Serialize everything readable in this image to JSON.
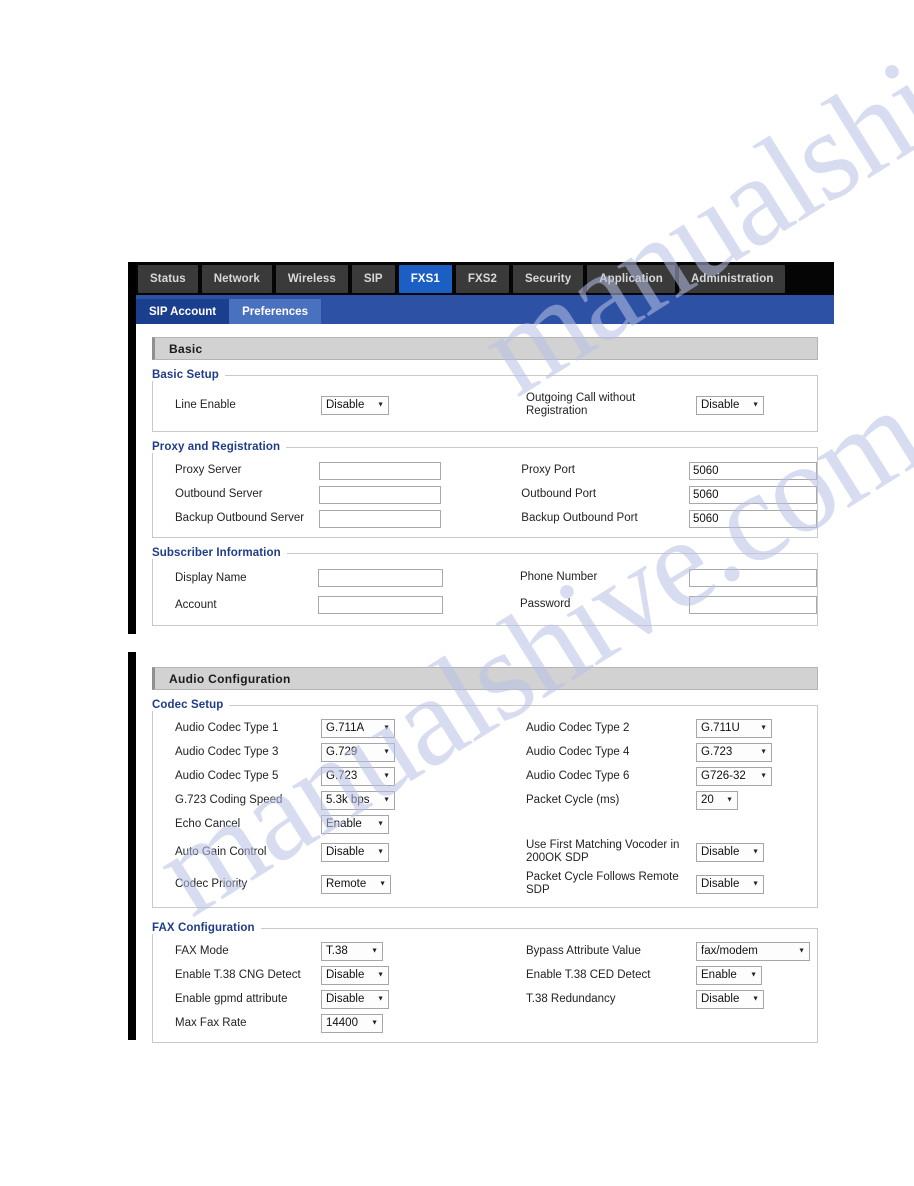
{
  "nav": {
    "tabs": [
      {
        "label": "Status",
        "active": false
      },
      {
        "label": "Network",
        "active": false
      },
      {
        "label": "Wireless",
        "active": false
      },
      {
        "label": "SIP",
        "active": false
      },
      {
        "label": "FXS1",
        "active": true
      },
      {
        "label": "FXS2",
        "active": false
      },
      {
        "label": "Security",
        "active": false
      },
      {
        "label": "Application",
        "active": false
      },
      {
        "label": "Administration",
        "active": false
      }
    ]
  },
  "subnav": {
    "tabs": [
      {
        "label": "SIP Account",
        "active": true
      },
      {
        "label": "Preferences",
        "active": false
      }
    ]
  },
  "panel_basic": {
    "section_title": "Basic",
    "groups": {
      "basic_setup": {
        "legend": "Basic Setup",
        "rows": [
          {
            "left_label": "Line Enable",
            "left_value": "Disable",
            "right_label": "Outgoing Call without Registration",
            "right_value": "Disable"
          }
        ]
      },
      "proxy_registration": {
        "legend": "Proxy and Registration",
        "rows": [
          {
            "left_label": "Proxy Server",
            "left_value": "",
            "right_label": "Proxy Port",
            "right_value": "5060"
          },
          {
            "left_label": "Outbound Server",
            "left_value": "",
            "right_label": "Outbound Port",
            "right_value": "5060"
          },
          {
            "left_label": "Backup Outbound Server",
            "left_value": "",
            "right_label": "Backup Outbound Port",
            "right_value": "5060"
          }
        ]
      },
      "subscriber_information": {
        "legend": "Subscriber Information",
        "rows": [
          {
            "left_label": "Display Name",
            "left_value": "",
            "right_label": "Phone Number",
            "right_value": ""
          },
          {
            "left_label": "Account",
            "left_value": "",
            "right_label": "Password",
            "right_value": ""
          }
        ]
      }
    }
  },
  "panel_audio": {
    "section_title": "Audio Configuration",
    "groups": {
      "codec_setup": {
        "legend": "Codec Setup",
        "rows": [
          {
            "left_label": "Audio Codec Type 1",
            "left_value": "G.711A",
            "right_label": "Audio Codec Type 2",
            "right_value": "G.711U"
          },
          {
            "left_label": "Audio Codec Type 3",
            "left_value": "G.729",
            "right_label": "Audio Codec Type 4",
            "right_value": "G.723"
          },
          {
            "left_label": "Audio Codec Type 5",
            "left_value": "G.723",
            "right_label": "Audio Codec Type 6",
            "right_value": "G726-32"
          },
          {
            "left_label": "G.723 Coding Speed",
            "left_value": "5.3k bps",
            "right_label": "Packet Cycle (ms)",
            "right_value": "20"
          },
          {
            "left_label": "Echo Cancel",
            "left_value": "Enable",
            "right_label": "",
            "right_value": null
          },
          {
            "left_label": "Auto Gain Control",
            "left_value": "Disable",
            "right_label": "Use First Matching Vocoder in 200OK SDP",
            "right_value": "Disable"
          },
          {
            "left_label": "Codec Priority",
            "left_value": "Remote",
            "right_label": "Packet Cycle Follows Remote SDP",
            "right_value": "Disable"
          }
        ]
      },
      "fax_configuration": {
        "legend": "FAX Configuration",
        "rows": [
          {
            "left_label": "FAX Mode",
            "left_value": "T.38",
            "right_label": "Bypass Attribute Value",
            "right_value": "fax/modem"
          },
          {
            "left_label": "Enable T.38 CNG Detect",
            "left_value": "Disable",
            "right_label": "Enable T.38 CED Detect",
            "right_value": "Enable"
          },
          {
            "left_label": "Enable gpmd attribute",
            "left_value": "Disable",
            "right_label": "T.38 Redundancy",
            "right_value": "Disable"
          },
          {
            "left_label": "Max Fax Rate",
            "left_value": "14400",
            "right_label": "",
            "right_value": null
          }
        ]
      }
    }
  },
  "watermark": {
    "line1": "manualshive.com",
    "line2": "manualshive.com"
  },
  "colors": {
    "nav_bg": "#050505",
    "tab_bg": "#3a3a3a",
    "tab_active_bg": "#1c5fc4",
    "subnav_bg": "#2d52a5",
    "subtab_active_bg": "#1b3f8f",
    "subtab_inactive_bg": "#4a71bf",
    "section_header_bg": "#d2d2d2",
    "legend_color": "#1f3d86"
  }
}
